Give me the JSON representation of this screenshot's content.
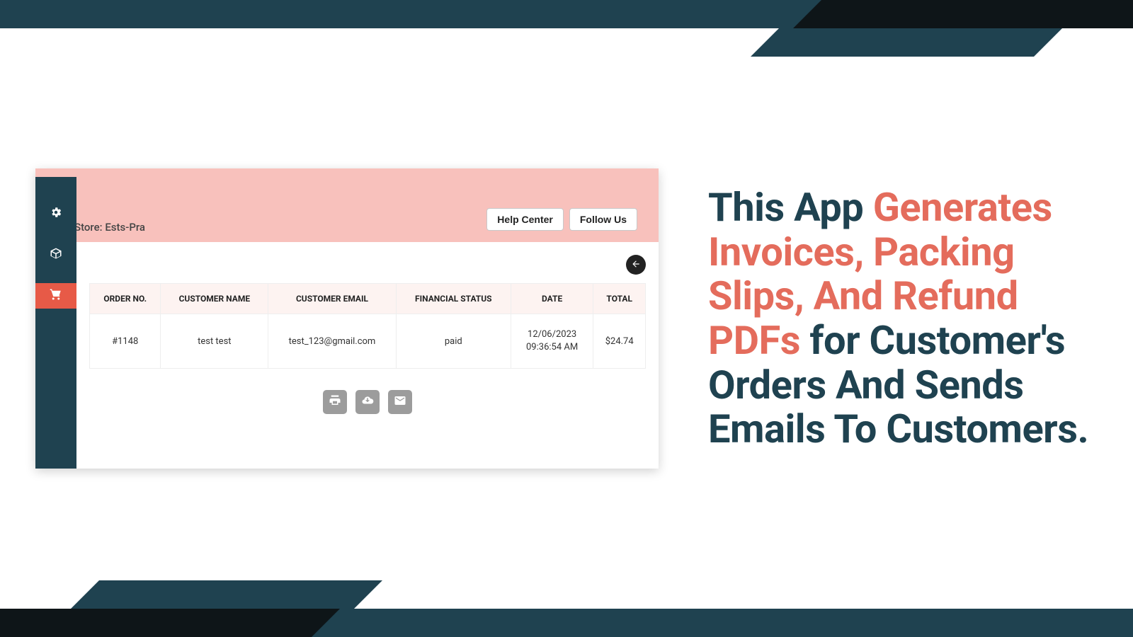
{
  "colors": {
    "brand_dark": "#1f4250",
    "accent": "#e46c5c",
    "header_pink": "#f8c1bc",
    "sidebar_active": "#e75a47"
  },
  "header": {
    "store_prefix": "Store:",
    "store_name": "Ests-Pra",
    "help_center": "Help Center",
    "follow_us": "Follow Us"
  },
  "sidebar": {
    "items": [
      {
        "name": "settings",
        "icon": "gear-icon",
        "active": false
      },
      {
        "name": "templates",
        "icon": "box-icon",
        "active": false
      },
      {
        "name": "orders",
        "icon": "cart-icon",
        "active": true
      }
    ]
  },
  "table": {
    "columns": [
      "ORDER NO.",
      "CUSTOMER NAME",
      "CUSTOMER EMAIL",
      "FINANCIAL STATUS",
      "DATE",
      "TOTAL"
    ],
    "rows": [
      {
        "order_no": "#1148",
        "customer_name": "test test",
        "customer_email": "test_123@gmail.com",
        "financial_status": "paid",
        "date_line1": "12/06/2023",
        "date_line2": "09:36:54 AM",
        "total": "$24.74"
      }
    ]
  },
  "actions": {
    "print": "Print",
    "download": "Download",
    "email": "Email"
  },
  "marketing": {
    "part1": "This App ",
    "highlight": "Generates Invoices, Packing Slips, And Refund PDFs",
    "part2": " for Customer's Orders And Sends Emails To Customers."
  }
}
